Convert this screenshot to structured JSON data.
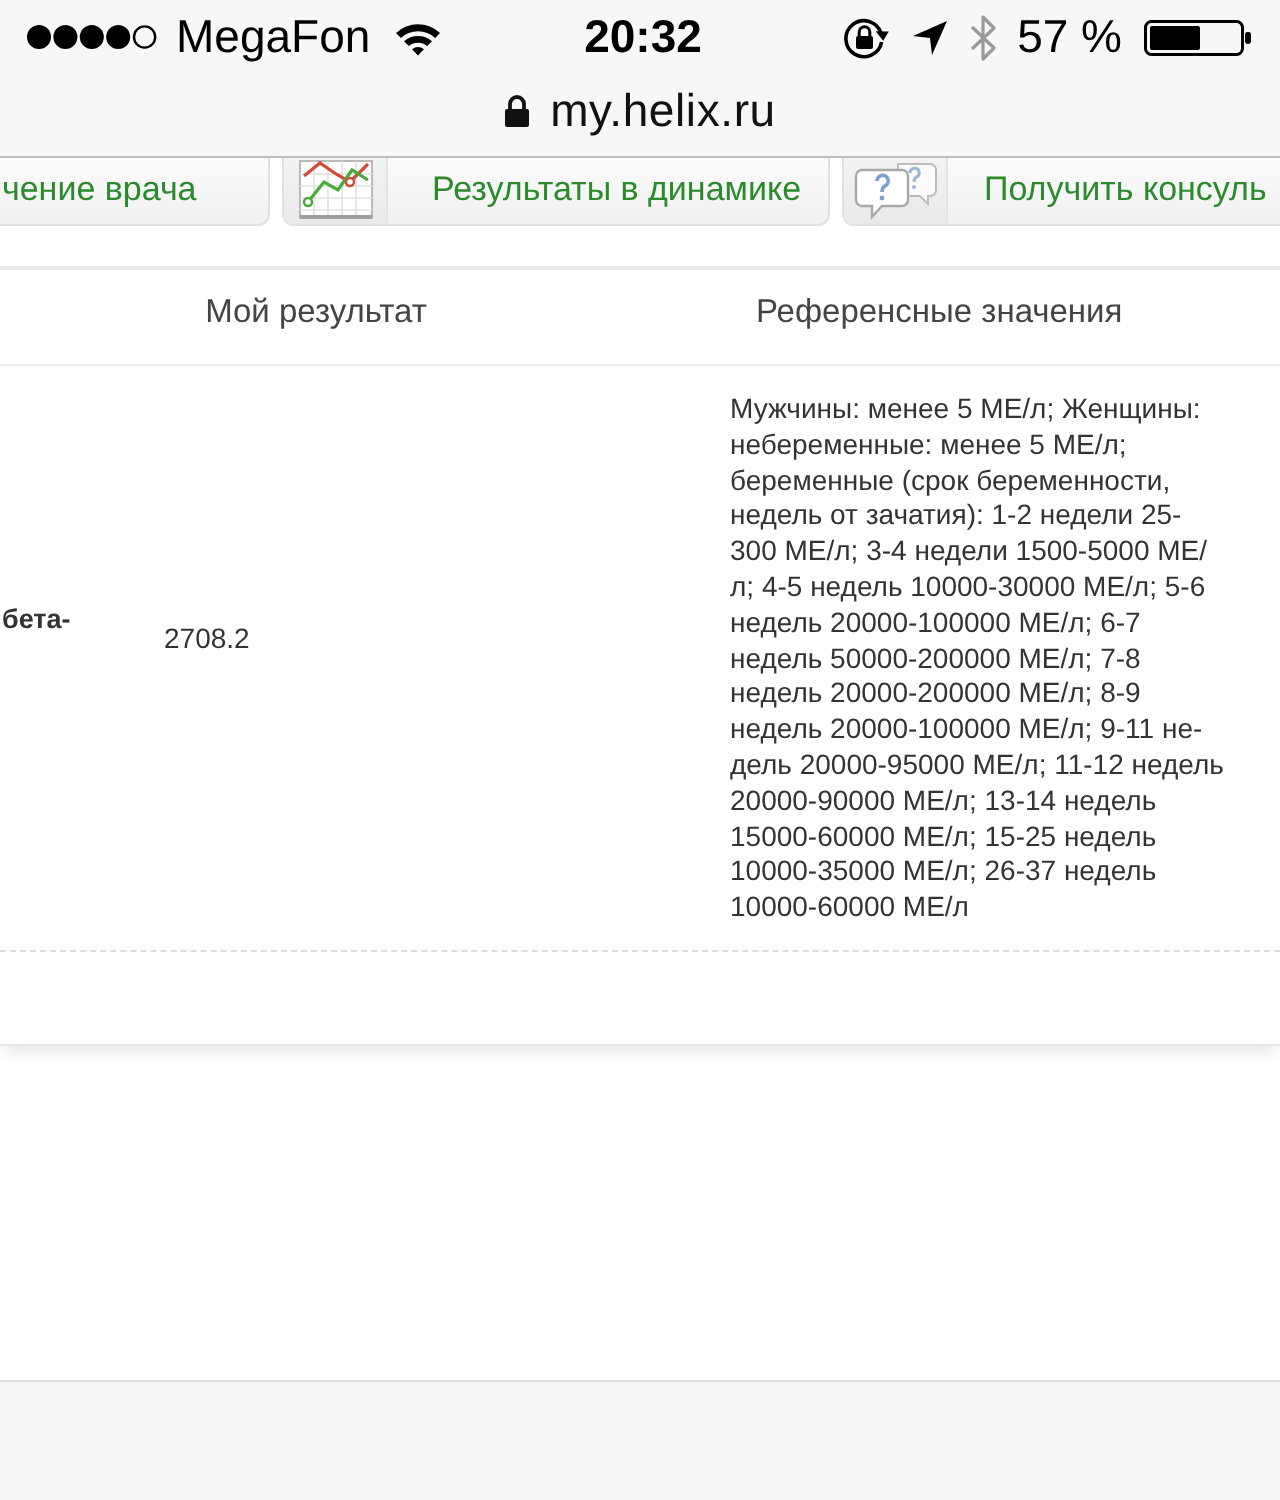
{
  "status_bar": {
    "carrier": "MegaFon",
    "time": "20:32",
    "battery": "57 %"
  },
  "address_bar": {
    "url": "my.helix.ru"
  },
  "action_buttons": [
    {
      "kind": "plain",
      "label": "чение врача"
    },
    {
      "kind": "chart",
      "label": "Результаты в динамике"
    },
    {
      "kind": "consult",
      "label": "Получить консуль"
    }
  ],
  "table": {
    "columns": [
      {
        "label": "Мой результат"
      },
      {
        "label": "Референсные значения"
      }
    ],
    "rows": [
      {
        "column_1": "бета-",
        "result": "2708.2",
        "reference": "Мужчины: менее 5 МЕ/л; Женщины: небеременные: менее 5 МЕ/л; беременные (срок беременности, недель от зачатия): 1-2 недели 25-300 МЕ/л; 3-4 недели 1500-5000 МЕ/л; 4-5 недель 10000-30000 МЕ/л; 5-6 недель 20000-100000 МЕ/л; 6-7 недель 50000-200000 МЕ/л; 7-8 недель 20000-200000 МЕ/л; 8-9 недель 20000-100000 МЕ/л; 9-11 не-дель 20000-95000 МЕ/л; 11-12 недель 20000-90000 МЕ/л; 13-14 недель 15000-60000 МЕ/л; 15-25 недель 10000-35000 МЕ/л; 26-37 недель 10000-60000 МЕ/л"
      }
    ]
  }
}
